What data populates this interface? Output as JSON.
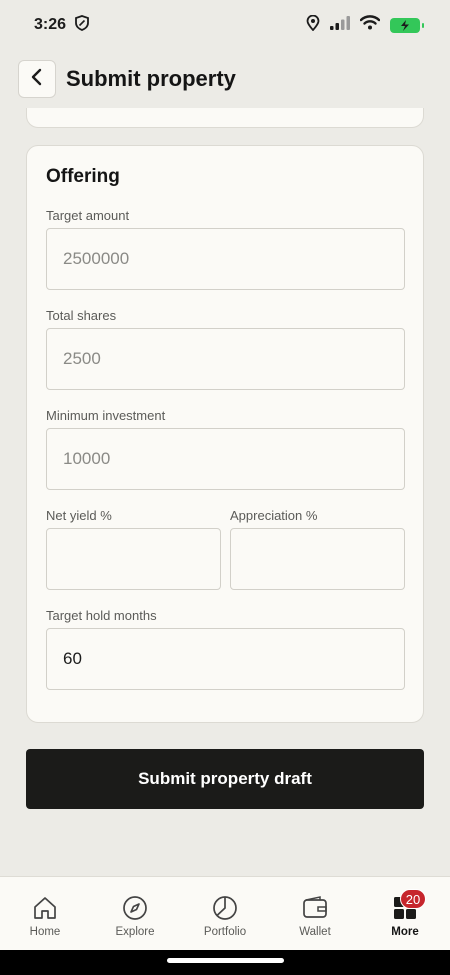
{
  "status_bar": {
    "time": "3:26",
    "icons": [
      "shield-icon",
      "location-icon",
      "signal-icon",
      "wifi-icon",
      "battery-icon"
    ],
    "battery_color": "#33c759"
  },
  "header": {
    "back_icon": "chevron-left-icon",
    "title": "Submit property"
  },
  "offering": {
    "title": "Offering",
    "target_amount": {
      "label": "Target amount",
      "placeholder": "2500000",
      "value": ""
    },
    "total_shares": {
      "label": "Total shares",
      "placeholder": "2500",
      "value": ""
    },
    "minimum_investment": {
      "label": "Minimum investment",
      "placeholder": "10000",
      "value": ""
    },
    "net_yield": {
      "label": "Net yield %",
      "placeholder": "",
      "value": ""
    },
    "appreciation": {
      "label": "Appreciation %",
      "placeholder": "",
      "value": ""
    },
    "target_hold_months": {
      "label": "Target hold months",
      "placeholder": "",
      "value": "60"
    }
  },
  "submit": {
    "label": "Submit property draft",
    "color": "#1b1b19"
  },
  "nav": {
    "items": [
      {
        "label": "Home",
        "icon": "home-icon"
      },
      {
        "label": "Explore",
        "icon": "compass-icon"
      },
      {
        "label": "Portfolio",
        "icon": "pie-chart-icon"
      },
      {
        "label": "Wallet",
        "icon": "wallet-icon"
      },
      {
        "label": "More",
        "icon": "grid-icon",
        "badge": "20",
        "active": true
      }
    ],
    "badge_color": "#c6252c"
  }
}
